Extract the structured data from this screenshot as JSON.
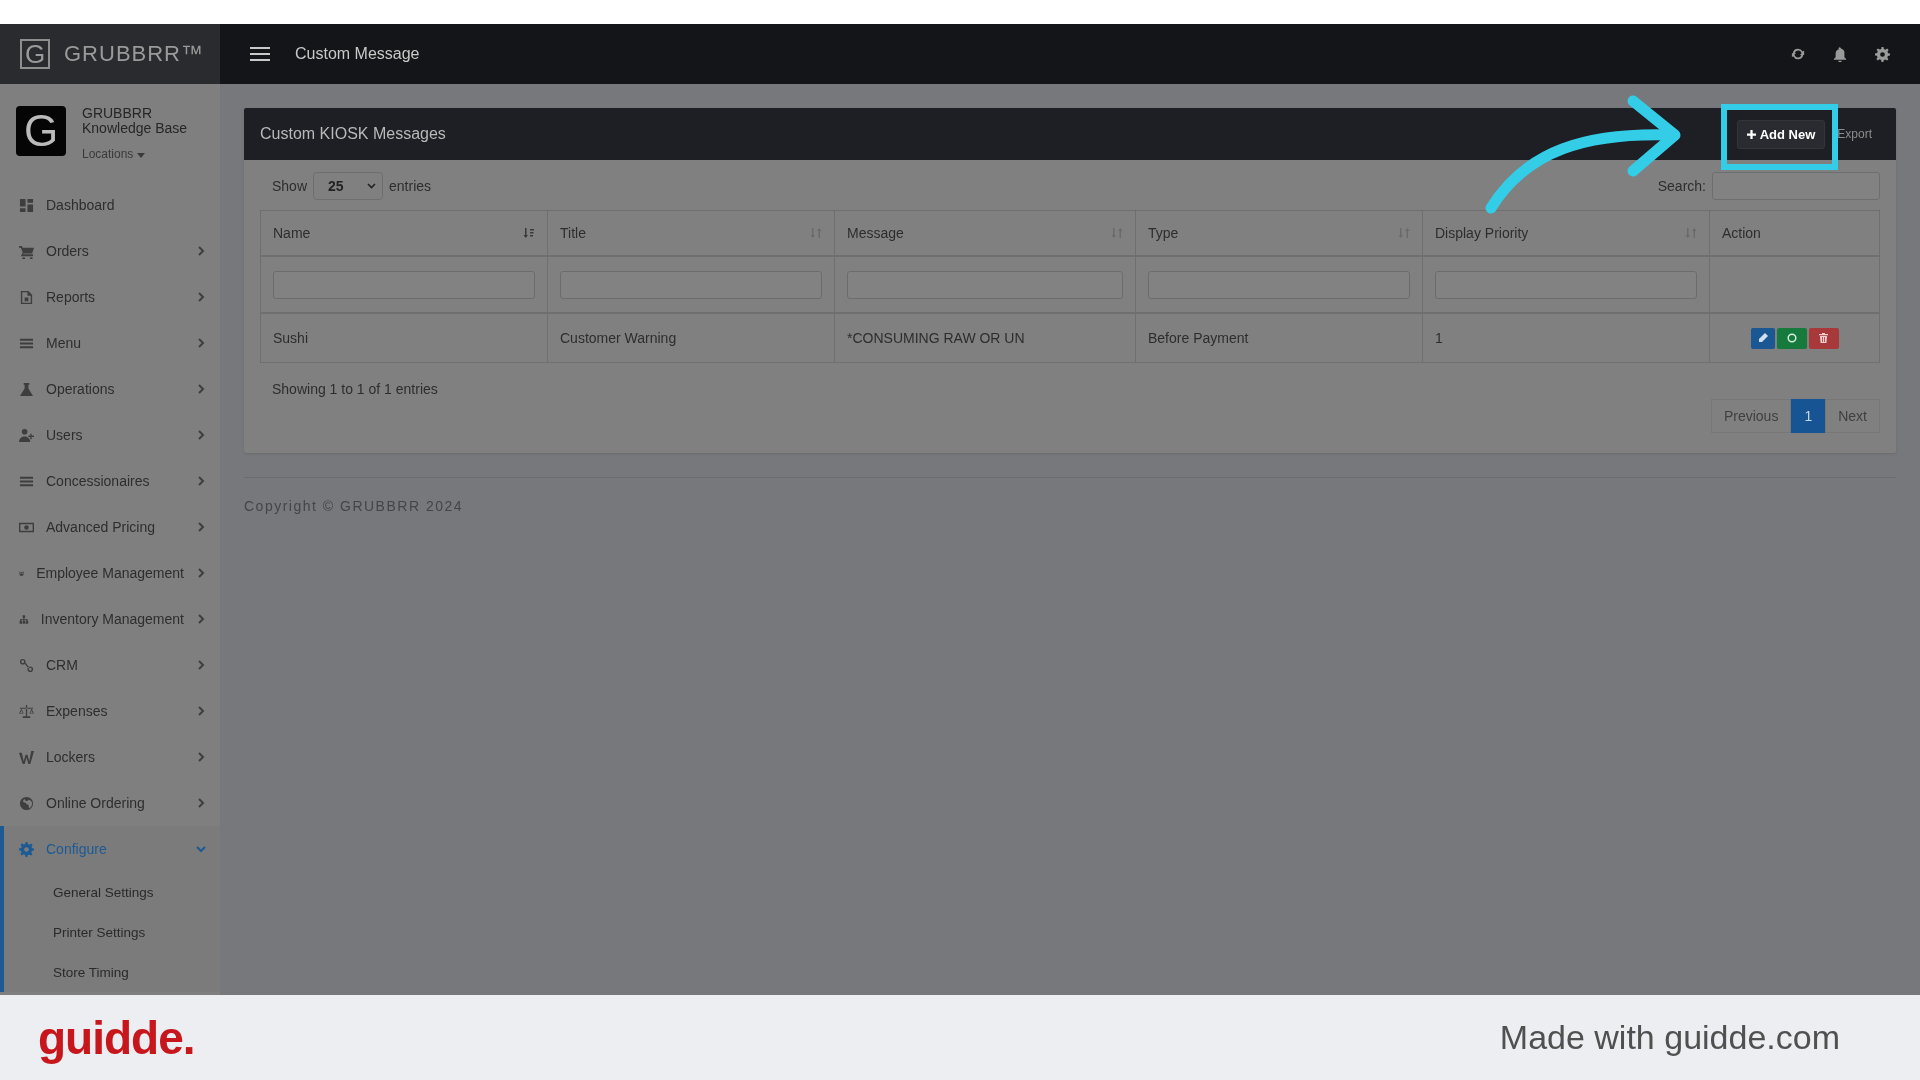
{
  "brand": {
    "logo_letter": "G",
    "name": "GRUBBRR™"
  },
  "topbar": {
    "title": "Custom Message"
  },
  "profile": {
    "avatar_letter": "G",
    "name": "GRUBBRR",
    "subtitle": "Knowledge Base",
    "locations": "Locations"
  },
  "sidebar": {
    "items": [
      {
        "label": "Dashboard",
        "expandable": false,
        "selected": false
      },
      {
        "label": "Orders",
        "expandable": true,
        "expanded": false,
        "selected": false
      },
      {
        "label": "Reports",
        "expandable": true,
        "expanded": false,
        "selected": false
      },
      {
        "label": "Menu",
        "expandable": true,
        "expanded": false,
        "selected": false
      },
      {
        "label": "Operations",
        "expandable": true,
        "expanded": false,
        "selected": false
      },
      {
        "label": "Users",
        "expandable": true,
        "expanded": false,
        "selected": false
      },
      {
        "label": "Concessionaires",
        "expandable": true,
        "expanded": false,
        "selected": false
      },
      {
        "label": "Advanced Pricing",
        "expandable": true,
        "expanded": false,
        "selected": false
      },
      {
        "label": "Employee Management",
        "expandable": true,
        "expanded": false,
        "selected": false
      },
      {
        "label": "Inventory Management",
        "expandable": true,
        "expanded": false,
        "selected": false
      },
      {
        "label": "CRM",
        "expandable": true,
        "expanded": false,
        "selected": false
      },
      {
        "label": "Expenses",
        "expandable": true,
        "expanded": false,
        "selected": false
      },
      {
        "label": "Lockers",
        "expandable": true,
        "expanded": false,
        "selected": false
      },
      {
        "label": "Online Ordering",
        "expandable": true,
        "expanded": false,
        "selected": false
      },
      {
        "label": "Configure",
        "expandable": true,
        "expanded": true,
        "selected": true,
        "children": [
          {
            "label": "General Settings"
          },
          {
            "label": "Printer Settings"
          },
          {
            "label": "Store Timing"
          }
        ]
      }
    ]
  },
  "panel": {
    "title": "Custom KIOSK Messages",
    "buttons": [
      {
        "label": "Add New",
        "kind": "primary"
      },
      {
        "label": "Export",
        "kind": "link"
      }
    ],
    "show_label": "Show",
    "page_size": "25",
    "entries_label": "entries",
    "search_label": "Search:",
    "table": {
      "columns": [
        {
          "label": "Name",
          "sortable": true,
          "sorted": true
        },
        {
          "label": "Title",
          "sortable": true,
          "sorted": false
        },
        {
          "label": "Message",
          "sortable": true,
          "sorted": false
        },
        {
          "label": "Type",
          "sortable": true,
          "sorted": false
        },
        {
          "label": "Display Priority",
          "sortable": true,
          "sorted": false
        },
        {
          "label": "Action",
          "sortable": false
        }
      ],
      "rows": [
        {
          "cells": [
            "Sushi",
            "Customer Warning",
            "*CONSUMING RAW OR UN",
            "Before Payment",
            "1"
          ]
        }
      ]
    },
    "info": "Showing 1 to 1 of 1 entries",
    "pagination": [
      {
        "label": "Previous",
        "selected": false
      },
      {
        "label": "1",
        "selected": true
      },
      {
        "label": "Next",
        "selected": false
      }
    ]
  },
  "copyright": "Copyright © GRUBBRR 2024",
  "footer": {
    "logo": "guidde.",
    "tagline": "Made with guidde.com"
  }
}
